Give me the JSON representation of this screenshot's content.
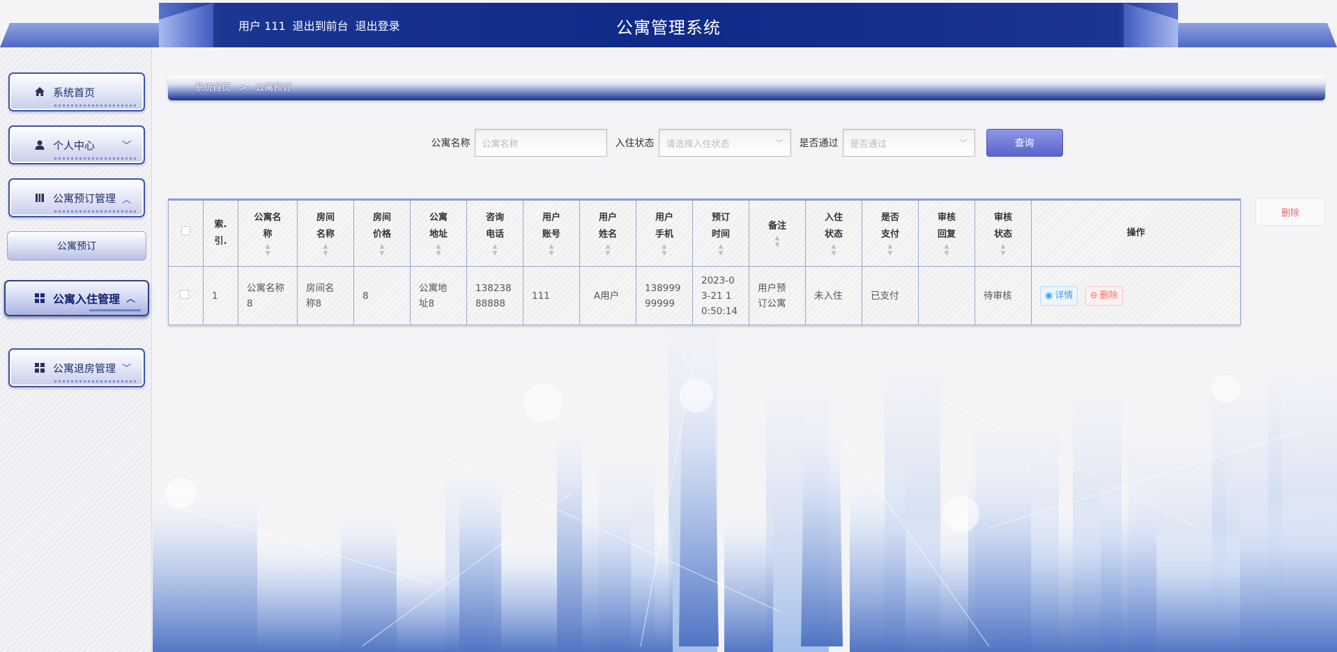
{
  "header": {
    "user_label": "用户 111",
    "front_link": "退出到前台",
    "logout_link": "退出登录",
    "title": "公寓管理系统"
  },
  "sidebar": {
    "items": [
      {
        "label": "系统首页",
        "icon": "home-icon"
      },
      {
        "label": "个人中心",
        "icon": "user-icon"
      },
      {
        "label": "公寓预订管理",
        "icon": "book-icon"
      },
      {
        "label": "公寓预订",
        "icon": ""
      },
      {
        "label": "公寓入住管理",
        "icon": "grid-icon"
      },
      {
        "label": "公寓退房管理",
        "icon": "grid-icon"
      }
    ]
  },
  "breadcrumb": {
    "home": "系统首页",
    "separator": ">",
    "current": "公寓预订"
  },
  "search": {
    "name_label": "公寓名称",
    "name_placeholder": "公寓名称",
    "status_label": "入住状态",
    "status_placeholder": "请选择入住状态",
    "approved_label": "是否通过",
    "approved_placeholder": "是否通过",
    "query_button": "查询"
  },
  "bulk_delete": "删除",
  "table": {
    "headers": [
      {
        "l1": "索.",
        "l2": "引.",
        "sortable": false
      },
      {
        "l1": "公寓名",
        "l2": "称",
        "sortable": true
      },
      {
        "l1": "房间",
        "l2": "名称",
        "sortable": true
      },
      {
        "l1": "房间",
        "l2": "价格",
        "sortable": true
      },
      {
        "l1": "公寓",
        "l2": "地址",
        "sortable": true
      },
      {
        "l1": "咨询",
        "l2": "电话",
        "sortable": true
      },
      {
        "l1": "用户",
        "l2": "账号",
        "sortable": true
      },
      {
        "l1": "用户",
        "l2": "姓名",
        "sortable": true
      },
      {
        "l1": "用户",
        "l2": "手机",
        "sortable": true
      },
      {
        "l1": "预订",
        "l2": "时间",
        "sortable": true
      },
      {
        "l1": "备注",
        "l2": "",
        "sortable": true
      },
      {
        "l1": "入住",
        "l2": "状态",
        "sortable": true
      },
      {
        "l1": "是否",
        "l2": "支付",
        "sortable": true
      },
      {
        "l1": "审核",
        "l2": "回复",
        "sortable": true
      },
      {
        "l1": "审核",
        "l2": "状态",
        "sortable": true
      },
      {
        "l1": "操作",
        "l2": "",
        "sortable": false
      }
    ],
    "rows": [
      {
        "index": "1",
        "apartment_name": [
          "公寓名称",
          "8"
        ],
        "room_name": [
          "房间名",
          "称8"
        ],
        "room_price": "8",
        "address": [
          "公寓地",
          "址8"
        ],
        "phone": [
          "138238",
          "88888"
        ],
        "account": "111",
        "user_name": "A用户",
        "user_phone": [
          "138999",
          "99999"
        ],
        "booking_time": [
          "2023-0",
          "3-21 1",
          "0:50:14"
        ],
        "remark": [
          "用户预",
          "订公寓"
        ],
        "checkin_status": "未入住",
        "paid": "已支付",
        "review_reply": "",
        "review_status": "待审核",
        "detail_btn": "详情",
        "delete_btn": "删除"
      }
    ]
  }
}
